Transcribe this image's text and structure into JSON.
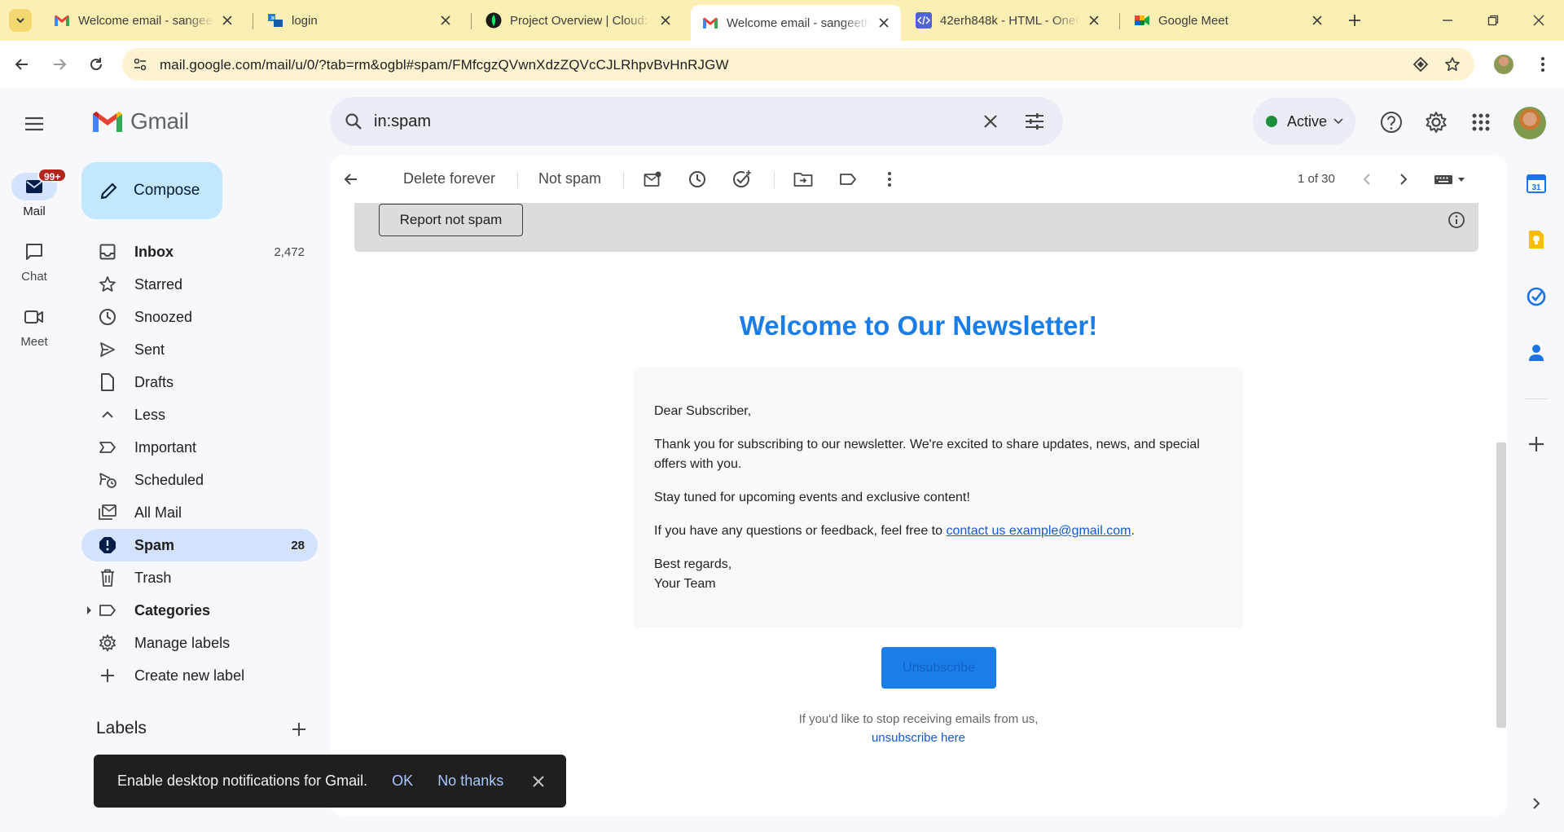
{
  "browser": {
    "tabs": [
      {
        "title": "Welcome email - sangeetha",
        "icon": "gmail-icon"
      },
      {
        "title": "login",
        "icon": "generic-site-icon"
      },
      {
        "title": "Project Overview | Cloud: MongoDB",
        "icon": "mongodb-icon"
      },
      {
        "title": "Welcome email - sangeetha",
        "icon": "gmail-icon"
      },
      {
        "title": "42erh848k - HTML - OneCompiler",
        "icon": "code-icon"
      },
      {
        "title": "Google Meet",
        "icon": "meet-icon"
      }
    ],
    "url": "mail.google.com/mail/u/0/?tab=rm&ogbl#spam/FMfcgzQVwnXdzZQVcCJLRhpvBvHnRJGW"
  },
  "gmail": {
    "brand": "Gmail",
    "search": {
      "query": "in:spam"
    },
    "status": "Active",
    "rail": [
      {
        "label": "Mail",
        "badge": "99+"
      },
      {
        "label": "Chat"
      },
      {
        "label": "Meet"
      }
    ],
    "compose_label": "Compose",
    "nav": [
      {
        "label": "Inbox",
        "count": "2,472",
        "bold": true
      },
      {
        "label": "Starred"
      },
      {
        "label": "Snoozed"
      },
      {
        "label": "Sent"
      },
      {
        "label": "Drafts"
      },
      {
        "label": "Less"
      },
      {
        "label": "Important"
      },
      {
        "label": "Scheduled"
      },
      {
        "label": "All Mail"
      },
      {
        "label": "Spam",
        "count": "28",
        "bold": true
      },
      {
        "label": "Trash"
      },
      {
        "label": "Categories",
        "bold": true
      },
      {
        "label": "Manage labels"
      },
      {
        "label": "Create new label"
      }
    ],
    "labels_heading": "Labels",
    "actions": {
      "delete_forever": "Delete forever",
      "not_spam": "Not spam",
      "pager": "1 of 30"
    },
    "spam_banner": {
      "button": "Report not spam"
    },
    "email": {
      "title": "Welcome to Our Newsletter!",
      "greeting": "Dear Subscriber,",
      "para1": "Thank you for subscribing to our newsletter. We're excited to share updates, news, and special offers with you.",
      "para2": "Stay tuned for upcoming events and exclusive content!",
      "para3_prefix": "If you have any questions or feedback, feel free to",
      "para3_link": "contact us example@gmail.com",
      "para3_suffix": ".",
      "sign1": "Best regards,",
      "sign2": "Your Team",
      "unsubscribe_button": "Unsubscribe",
      "footer_text": "If you'd like to stop receiving emails from us,",
      "footer_link": "unsubscribe here"
    },
    "toast": {
      "message": "Enable desktop notifications for Gmail.",
      "ok": "OK",
      "no_thanks": "No thanks"
    }
  }
}
